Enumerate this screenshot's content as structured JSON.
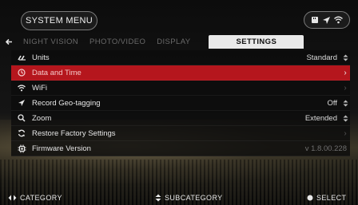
{
  "header": {
    "title": "SYSTEM MENU",
    "status_icons": [
      "sd-card-icon",
      "gps-icon",
      "wifi-icon"
    ]
  },
  "tabs": [
    {
      "label": "NIGHT VISION",
      "active": false
    },
    {
      "label": "PHOTO/VIDEO",
      "active": false
    },
    {
      "label": "DISPLAY",
      "active": false
    },
    {
      "label": "SETTINGS",
      "active": true
    }
  ],
  "settings": [
    {
      "label": "Units",
      "value": "Standard",
      "control": "stepper",
      "icon": "ruler-icon"
    },
    {
      "label": "Data and Time",
      "value": "",
      "control": "arrow",
      "icon": "clock-icon",
      "selected": true
    },
    {
      "label": "WiFi",
      "value": "",
      "control": "arrow",
      "icon": "wifi-icon"
    },
    {
      "label": "Record Geo-tagging",
      "value": "Off",
      "control": "stepper",
      "icon": "location-arrow-icon"
    },
    {
      "label": "Zoom",
      "value": "Extended",
      "control": "stepper",
      "icon": "magnifier-icon"
    },
    {
      "label": "Restore Factory Settings",
      "value": "",
      "control": "arrow",
      "icon": "refresh-icon"
    },
    {
      "label": "Firmware Version",
      "value": "v 1.8.00.228",
      "control": "none",
      "icon": "chip-icon"
    }
  ],
  "footer": {
    "category": "CATEGORY",
    "subcategory": "SUBCATEGORY",
    "select": "SELECT"
  },
  "colors": {
    "selected_row": "#b5161d",
    "active_tab_bg": "#e9e9e9"
  }
}
